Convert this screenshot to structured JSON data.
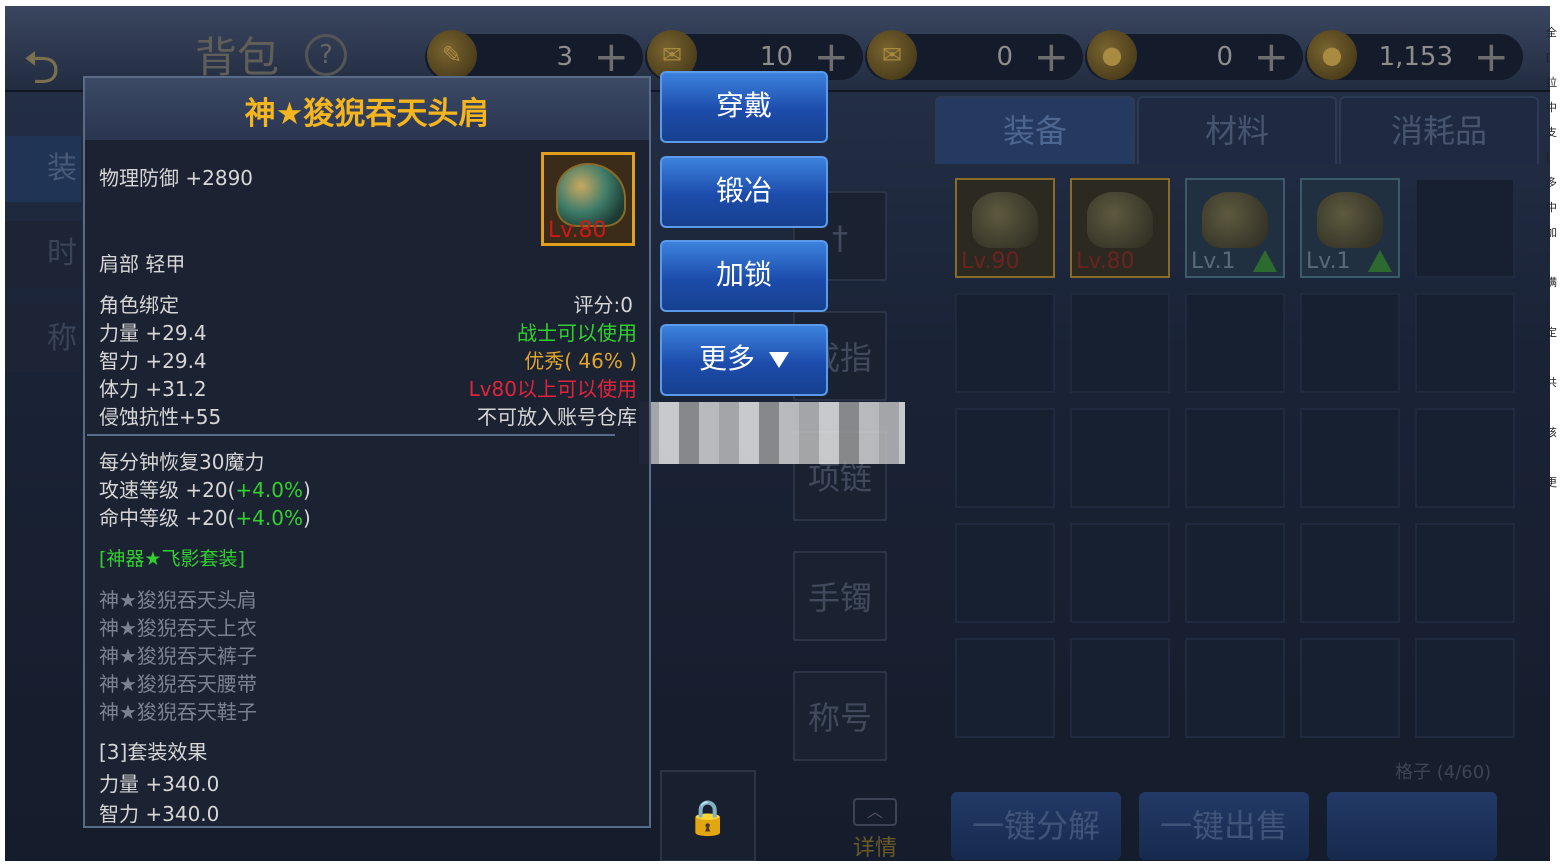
{
  "topbar": {
    "title": "背包",
    "currencies": [
      {
        "icon": "feather-icon",
        "value": "3"
      },
      {
        "icon": "scroll-icon",
        "value": "10"
      },
      {
        "icon": "locked-scroll-icon",
        "value": "0"
      },
      {
        "icon": "gold-coin-icon",
        "value": "0"
      },
      {
        "icon": "locked-coin-icon",
        "value": "1,153"
      }
    ],
    "plus": "+"
  },
  "left_tabs": [
    "装",
    "时",
    "称"
  ],
  "right_tabs": [
    "装备",
    "材料",
    "消耗品"
  ],
  "equip_slots": [
    "戒指",
    "项链",
    "手镯",
    "称号"
  ],
  "grid": {
    "items": [
      {
        "level": "Lv.90",
        "kind": "gold"
      },
      {
        "level": "Lv.80",
        "kind": "gold"
      },
      {
        "level": "Lv.1",
        "kind": "blue",
        "upgrade": true
      },
      {
        "level": "Lv.1",
        "kind": "blue",
        "upgrade": true
      }
    ],
    "count": "格子 (4/60)"
  },
  "bottom_buttons": [
    "一键分解",
    "一键出售"
  ],
  "detail": "详情",
  "tooltip": {
    "title": "神★狻猊吞天头肩",
    "defense": "物理防御 +2890",
    "icon_level": "Lv.80",
    "slot_type": "肩部 轻甲",
    "bind": "角色绑定",
    "score": "评分:0",
    "stats": [
      "力量 +29.4",
      "智力 +29.4",
      "体力 +31.2",
      "侵蚀抗性+55"
    ],
    "class_req": "战士可以使用",
    "quality": "优秀( 46% )",
    "level_req": "Lv80以上可以使用",
    "storage": "不可放入账号仓库",
    "extra": [
      {
        "text": "每分钟恢复30魔力",
        "bonus": ""
      },
      {
        "text": "攻速等级 +20(",
        "bonus": "+4.0%",
        "tail": ")"
      },
      {
        "text": "命中等级 +20(",
        "bonus": "+4.0%",
        "tail": ")"
      }
    ],
    "set_name": "[神器★飞影套装]",
    "set_items": [
      "神★狻猊吞天头肩",
      "神★狻猊吞天上衣",
      "神★狻猊吞天裤子",
      "神★狻猊吞天腰带",
      "神★狻猊吞天鞋子"
    ],
    "set_effect_title": "[3]套装效果",
    "set_effects": [
      "力量 +340.0",
      "智力 +340.0"
    ]
  },
  "actions": {
    "wear": "穿戴",
    "forge": "锻冶",
    "lock": "加锁",
    "more": "更多"
  },
  "colors": {
    "title": "#f4b51e",
    "green": "#32d02f",
    "orange": "#e0a52a",
    "red": "#e0243c",
    "button": "#1c4cab"
  }
}
